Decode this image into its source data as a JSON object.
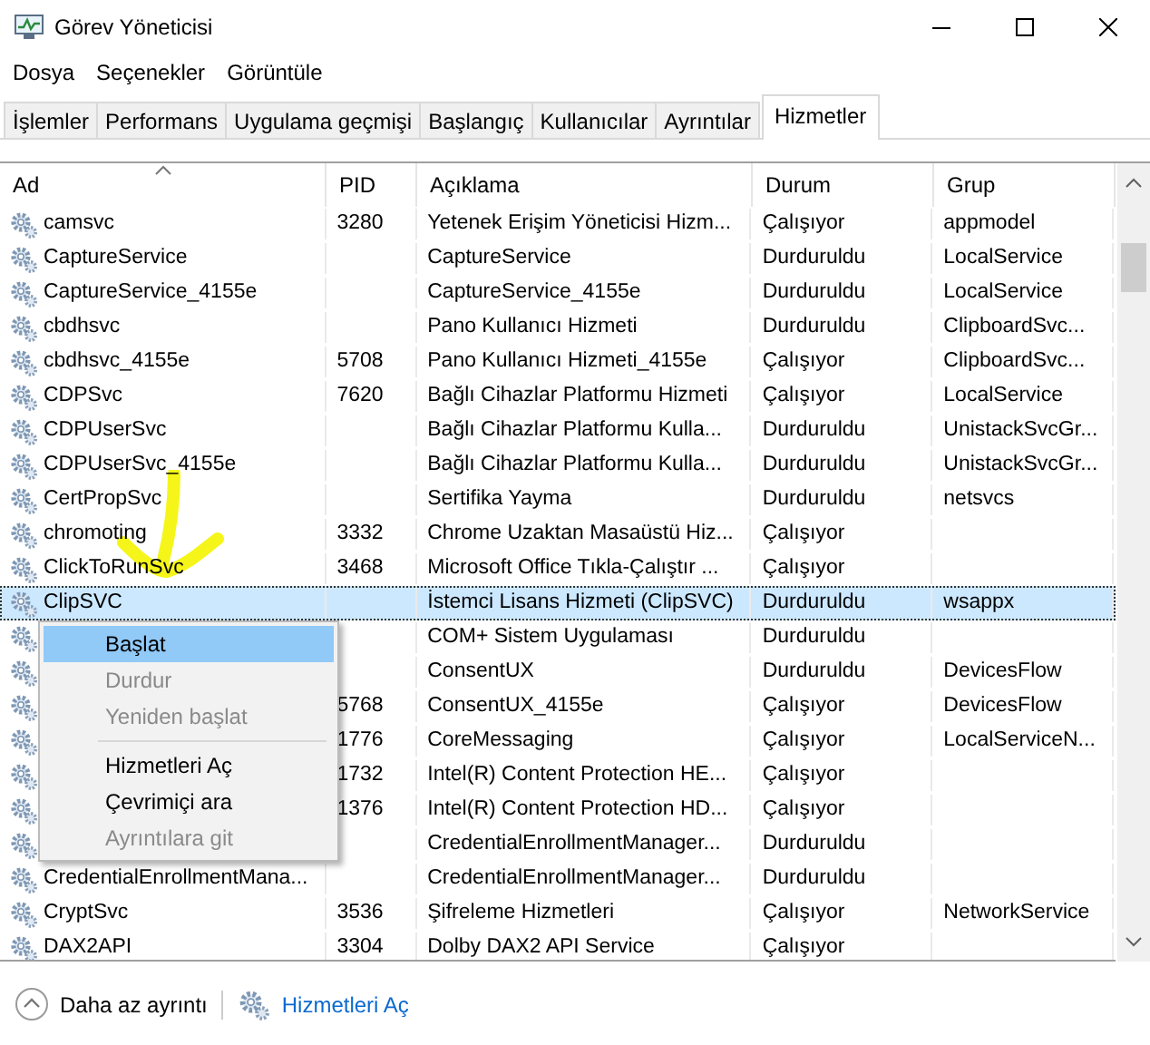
{
  "window": {
    "title": "Görev Yöneticisi"
  },
  "menu": [
    "Dosya",
    "Seçenekler",
    "Görüntüle"
  ],
  "tabs": [
    {
      "label": "İşlemler",
      "selected": false
    },
    {
      "label": "Performans",
      "selected": false
    },
    {
      "label": "Uygulama geçmişi",
      "selected": false
    },
    {
      "label": "Başlangıç",
      "selected": false
    },
    {
      "label": "Kullanıcılar",
      "selected": false
    },
    {
      "label": "Ayrıntılar",
      "selected": false
    },
    {
      "label": "Hizmetler",
      "selected": true
    }
  ],
  "table": {
    "columns": [
      {
        "label": "Ad",
        "sorted": true
      },
      {
        "label": "PID",
        "sorted": false
      },
      {
        "label": "Açıklama",
        "sorted": false
      },
      {
        "label": "Durum",
        "sorted": false
      },
      {
        "label": "Grup",
        "sorted": false
      }
    ],
    "rows": [
      {
        "name": "camsvc",
        "pid": "3280",
        "description": "Yetenek Erişim Yöneticisi Hizm...",
        "status": "Çalışıyor",
        "group": "appmodel",
        "selected": false
      },
      {
        "name": "CaptureService",
        "description": "CaptureService",
        "status": "Durduruldu",
        "group": "LocalService",
        "selected": false
      },
      {
        "name": "CaptureService_4155e",
        "description": "CaptureService_4155e",
        "status": "Durduruldu",
        "group": "LocalService",
        "selected": false
      },
      {
        "name": "cbdhsvc",
        "description": "Pano Kullanıcı Hizmeti",
        "status": "Durduruldu",
        "group": "ClipboardSvc...",
        "selected": false
      },
      {
        "name": "cbdhsvc_4155e",
        "pid": "5708",
        "description": "Pano Kullanıcı Hizmeti_4155e",
        "status": "Çalışıyor",
        "group": "ClipboardSvc...",
        "selected": false
      },
      {
        "name": "CDPSvc",
        "pid": "7620",
        "description": "Bağlı Cihazlar Platformu Hizmeti",
        "status": "Çalışıyor",
        "group": "LocalService",
        "selected": false
      },
      {
        "name": "CDPUserSvc",
        "description": "Bağlı Cihazlar Platformu Kulla...",
        "status": "Durduruldu",
        "group": "UnistackSvcGr...",
        "selected": false
      },
      {
        "name": "CDPUserSvc_4155e",
        "description": "Bağlı Cihazlar Platformu Kulla...",
        "status": "Durduruldu",
        "group": "UnistackSvcGr...",
        "selected": false
      },
      {
        "name": "CertPropSvc",
        "description": "Sertifika Yayma",
        "status": "Durduruldu",
        "group": "netsvcs",
        "selected": false
      },
      {
        "name": "chromoting",
        "pid": "3332",
        "description": "Chrome Uzaktan Masaüstü Hiz...",
        "status": "Çalışıyor",
        "selected": false
      },
      {
        "name": "ClickToRunSvc",
        "pid": "3468",
        "description": "Microsoft Office Tıkla-Çalıştır ...",
        "status": "Çalışıyor",
        "selected": false
      },
      {
        "name": "ClipSVC",
        "description": "İstemci Lisans Hizmeti (ClipSVC)",
        "status": "Durduruldu",
        "group": "wsappx",
        "selected": true
      },
      {
        "description": "COM+ Sistem Uygulaması",
        "status": "Durduruldu",
        "selected": false
      },
      {
        "description": "ConsentUX",
        "status": "Durduruldu",
        "group": "DevicesFlow",
        "selected": false
      },
      {
        "pid": "5768",
        "description": "ConsentUX_4155e",
        "status": "Çalışıyor",
        "group": "DevicesFlow",
        "selected": false
      },
      {
        "pid": "1776",
        "description": "CoreMessaging",
        "status": "Çalışıyor",
        "group": "LocalServiceN...",
        "selected": false
      },
      {
        "pid": "1732",
        "description": "Intel(R) Content Protection HE...",
        "status": "Çalışıyor",
        "selected": false
      },
      {
        "pid": "1376",
        "description": "Intel(R) Content Protection HD...",
        "status": "Çalışıyor",
        "selected": false
      },
      {
        "description": "CredentialEnrollmentManager...",
        "status": "Durduruldu",
        "selected": false
      },
      {
        "name": "CredentialEnrollmentMana...",
        "description": "CredentialEnrollmentManager...",
        "status": "Durduruldu",
        "selected": false
      },
      {
        "name": "CryptSvc",
        "pid": "3536",
        "description": "Şifreleme Hizmetleri",
        "status": "Çalışıyor",
        "group": "NetworkService",
        "selected": false
      },
      {
        "name": "DAX2API",
        "pid": "3304",
        "description": "Dolby DAX2 API Service",
        "status": "Çalışıyor",
        "selected": false
      }
    ]
  },
  "context_menu": [
    {
      "kind": "item",
      "label": "Başlat",
      "disabled": false,
      "highlighted": true
    },
    {
      "kind": "item",
      "label": "Durdur",
      "disabled": true,
      "highlighted": false
    },
    {
      "kind": "item",
      "label": "Yeniden başlat",
      "disabled": true,
      "highlighted": false
    },
    {
      "kind": "separator"
    },
    {
      "kind": "item",
      "label": "Hizmetleri Aç",
      "disabled": false,
      "highlighted": false
    },
    {
      "kind": "item",
      "label": "Çevrimiçi ara",
      "disabled": false,
      "highlighted": false
    },
    {
      "kind": "item",
      "label": "Ayrıntılara git",
      "disabled": true,
      "highlighted": false
    }
  ],
  "footer": {
    "details_toggle": "Daha az ayrıntı",
    "open_services_link": "Hizmetleri Aç"
  }
}
